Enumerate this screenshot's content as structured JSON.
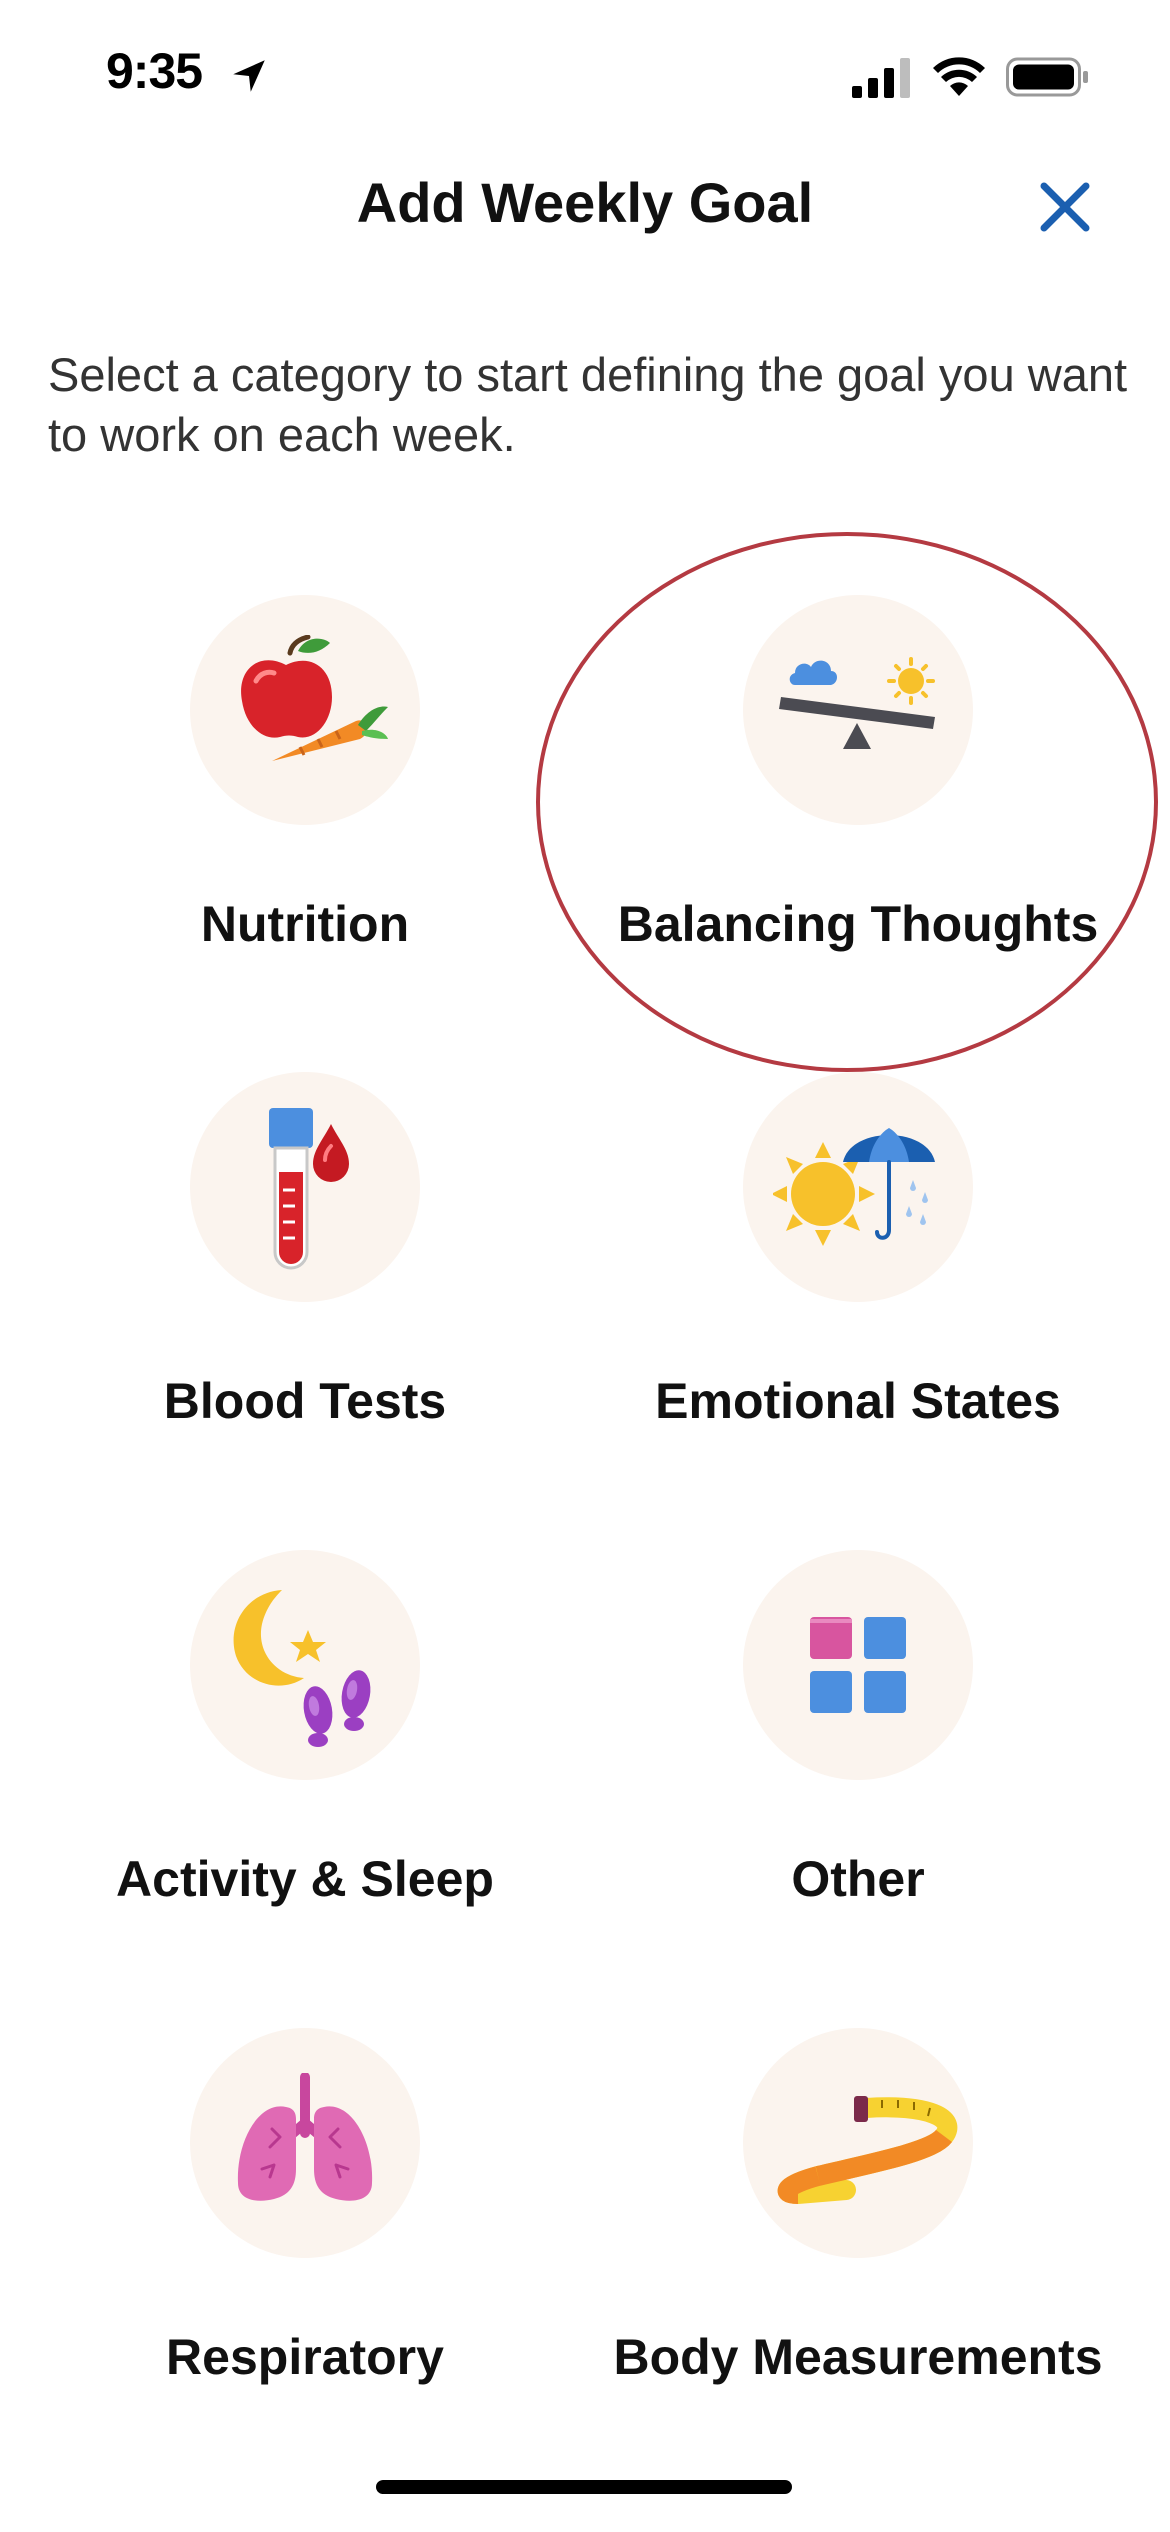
{
  "status_bar": {
    "time": "9:35",
    "icons": [
      "location-arrow-icon",
      "cellular-signal-icon",
      "wifi-icon",
      "battery-icon"
    ]
  },
  "header": {
    "title": "Add Weekly Goal",
    "close_icon": "close-icon",
    "accent_color": "#1b5fb0"
  },
  "intro_text": "Select a category to start defining the goal you want to work on each week.",
  "categories": [
    {
      "label": "Nutrition",
      "icon": "apple-carrot-icon"
    },
    {
      "label": "Balancing Thoughts",
      "icon": "seesaw-cloud-sun-icon",
      "highlighted": true
    },
    {
      "label": "Blood Tests",
      "icon": "test-tube-blood-drop-icon"
    },
    {
      "label": "Emotional States",
      "icon": "sun-umbrella-rain-icon"
    },
    {
      "label": "Activity & Sleep",
      "icon": "moon-footprints-icon"
    },
    {
      "label": "Other",
      "icon": "grid-squares-icon"
    },
    {
      "label": "Respiratory",
      "icon": "lungs-icon"
    },
    {
      "label": "Body Measurements",
      "icon": "measuring-tape-icon"
    }
  ],
  "highlight_color": "#b43a42"
}
